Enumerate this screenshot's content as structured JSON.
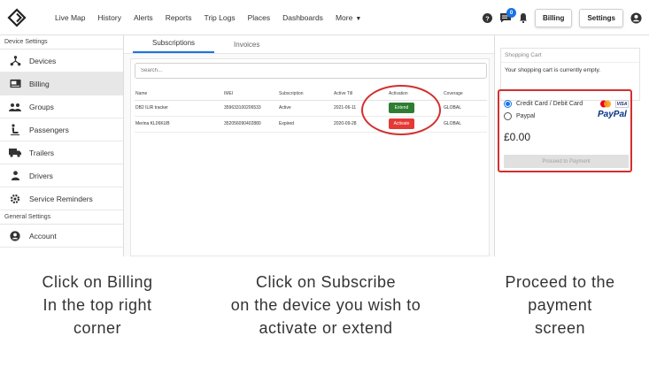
{
  "nav": {
    "links": [
      "Live Map",
      "History",
      "Alerts",
      "Reports",
      "Trip Logs",
      "Places",
      "Dashboards",
      "More"
    ],
    "notification_count": "0",
    "billing_label": "Billing",
    "settings_label": "Settings"
  },
  "sidebar": {
    "device_settings_title": "Device Settings",
    "device_items": [
      {
        "label": "Devices",
        "icon": "hierarchy-icon"
      },
      {
        "label": "Billing",
        "icon": "card-icon"
      },
      {
        "label": "Groups",
        "icon": "people-icon"
      },
      {
        "label": "Passengers",
        "icon": "passenger-icon"
      },
      {
        "label": "Trailers",
        "icon": "truck-icon"
      },
      {
        "label": "Drivers",
        "icon": "person-icon"
      },
      {
        "label": "Service Reminders",
        "icon": "gear-icon"
      }
    ],
    "general_settings_title": "General Settings",
    "general_items": [
      {
        "label": "Account",
        "icon": "account-icon"
      }
    ]
  },
  "tabs": [
    "Subscriptions",
    "Invoices"
  ],
  "search": {
    "placeholder": "Search..."
  },
  "table": {
    "headers": [
      "Name",
      "IMEI",
      "Subscription",
      "Active Till",
      "Activation",
      "Coverage"
    ],
    "rows": [
      {
        "name": "DB2 ILIR tracker",
        "imei": "359633100206533",
        "subscription": "Active",
        "active_till": "2021-06-11",
        "action": "Extend",
        "coverage": "GLOBAL"
      },
      {
        "name": "Merina KL06KUB",
        "imei": "352056090402880",
        "subscription": "Expired",
        "active_till": "2020-09-28",
        "action": "Activate",
        "coverage": "GLOBAL"
      }
    ]
  },
  "cart": {
    "title": "Shopping Cart",
    "empty_text": "Your shopping cart is currently empty.",
    "payment_options": [
      "Credit Card / Debit Card",
      "Paypal"
    ],
    "paypal_logo": "PayPal",
    "visa_logo": "VISA",
    "amount": "£0.00",
    "proceed_label": "Proceed to Payment"
  },
  "captions": [
    [
      "Click on Billing",
      "In the top right",
      "corner"
    ],
    [
      "Click on Subscribe",
      "on the device you wish to",
      "activate or extend"
    ],
    [
      "Proceed to the",
      "payment",
      "screen"
    ]
  ],
  "colors": {
    "accent": "#1a73e8",
    "extend": "#2e7d32",
    "activate": "#e53935",
    "highlight": "#d32f2f"
  }
}
